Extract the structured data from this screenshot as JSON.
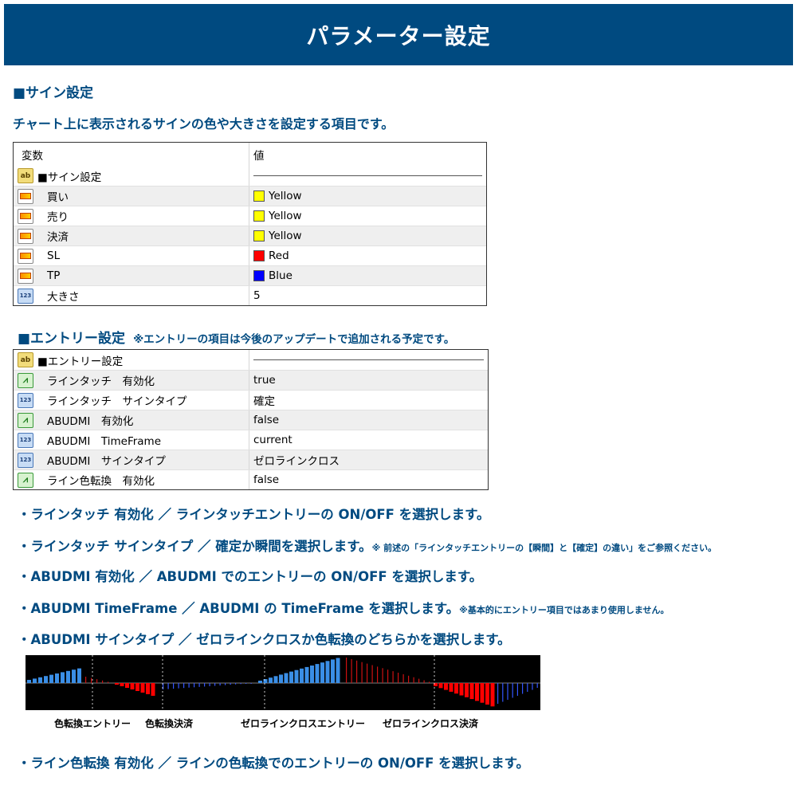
{
  "header": {
    "title": "パラメーター設定"
  },
  "sign_section": {
    "title": "■サイン設定",
    "description": "チャート上に表示されるサインの色や大きさを設定する項目です。",
    "table": {
      "col_variable": "変数",
      "col_value": "値",
      "group_label": "■サイン設定",
      "rows": [
        {
          "label": "買い",
          "value": "Yellow",
          "color": "#ffff00",
          "icon": "color-icon"
        },
        {
          "label": "売り",
          "value": "Yellow",
          "color": "#ffff00",
          "icon": "color-icon"
        },
        {
          "label": "決済",
          "value": "Yellow",
          "color": "#ffff00",
          "icon": "color-icon"
        },
        {
          "label": "SL",
          "value": "Red",
          "color": "#ff0000",
          "icon": "color-icon"
        },
        {
          "label": "TP",
          "value": "Blue",
          "color": "#0000ff",
          "icon": "color-icon"
        },
        {
          "label": "大きさ",
          "value": "5",
          "icon": "integer-icon"
        }
      ]
    }
  },
  "entry_section": {
    "title": "■エントリー設定",
    "note": "※エントリーの項目は今後のアップデートで追加される予定です。",
    "table": {
      "group_label": "■エントリー設定",
      "rows": [
        {
          "label": "ラインタッチ　有効化",
          "value": "true",
          "icon": "boolean-icon"
        },
        {
          "label": "ラインタッチ　サインタイプ",
          "value": "確定",
          "icon": "integer-icon"
        },
        {
          "label": "ABUDMI　有効化",
          "value": "false",
          "icon": "boolean-icon"
        },
        {
          "label": "ABUDMI　TimeFrame",
          "value": "current",
          "icon": "integer-icon"
        },
        {
          "label": "ABUDMI　サインタイプ",
          "value": "ゼロラインクロス",
          "icon": "integer-icon"
        },
        {
          "label": "ライン色転換　有効化",
          "value": "false",
          "icon": "boolean-icon"
        }
      ]
    }
  },
  "bullets": [
    {
      "text": "・ラインタッチ 有効化 ／ ラインタッチエントリーの ON/OFF を選択します。",
      "note": ""
    },
    {
      "text": "・ラインタッチ サインタイプ ／ 確定か瞬間を選択します。",
      "note": "※ 前述の「ラインタッチエントリーの【瞬間】と【確定】の違い」をご参照ください。"
    },
    {
      "text": "・ABUDMI 有効化 ／ ABUDMI でのエントリーの ON/OFF を選択します。",
      "note": ""
    },
    {
      "text": "・ABUDMI TimeFrame ／ ABUDMI の TimeFrame を選択します。",
      "note": "※基本的にエントリー項目ではあまり使用しません。"
    },
    {
      "text": "・ABUDMI サインタイプ ／ ゼロラインクロスか色転換のどちらかを選択します。",
      "note": ""
    },
    {
      "text": "・ライン色転換 有効化 ／ ラインの色転換でのエントリーの ON/OFF を選択します。",
      "note": ""
    }
  ],
  "chart_labels": {
    "color_change_entry": "色転換エントリー",
    "color_change_exit": "色転換決済",
    "zero_cross_entry": "ゼロラインクロスエントリー",
    "zero_cross_exit": "ゼロラインクロス決済"
  },
  "colors": {
    "navy": "#004a80",
    "bar_blue": "#3a8ee6",
    "bar_red": "#ff0000",
    "bar_thin_blue": "#3355ff",
    "bar_thin_red": "#cc1111"
  }
}
